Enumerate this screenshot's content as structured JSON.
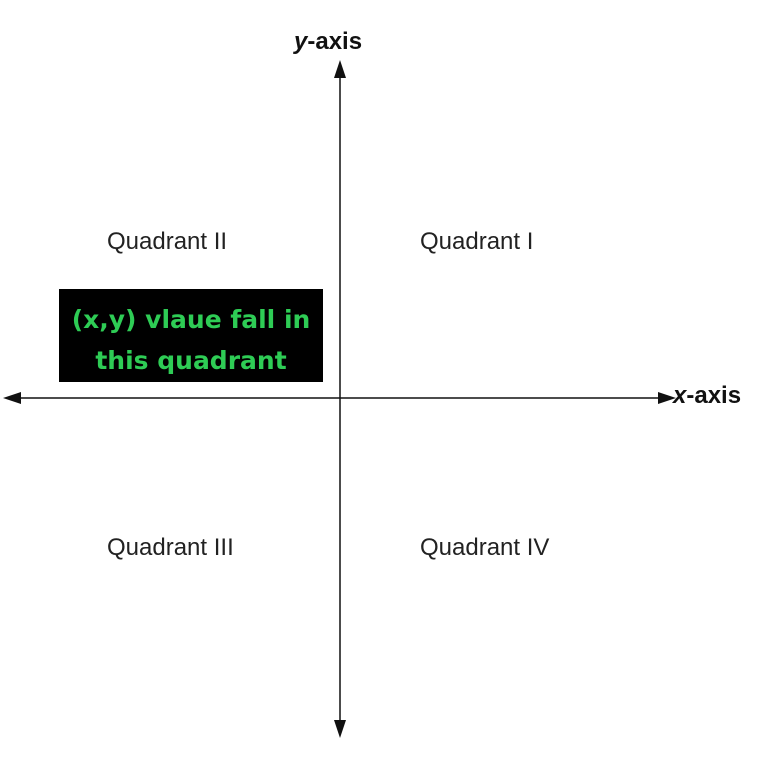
{
  "axes": {
    "y_axis": {
      "variable": "y",
      "suffix": "-axis"
    },
    "x_axis": {
      "variable": "x",
      "suffix": "-axis"
    }
  },
  "quadrants": [
    {
      "label": "Quadrant I"
    },
    {
      "label": "Quadrant II"
    },
    {
      "label": "Quadrant III"
    },
    {
      "label": "Quadrant IV"
    }
  ],
  "callout": {
    "lines": [
      "(x,y) vlaue fall in",
      "this quadrant"
    ],
    "background_color": "#000000",
    "text_color": "#2ecc55"
  }
}
